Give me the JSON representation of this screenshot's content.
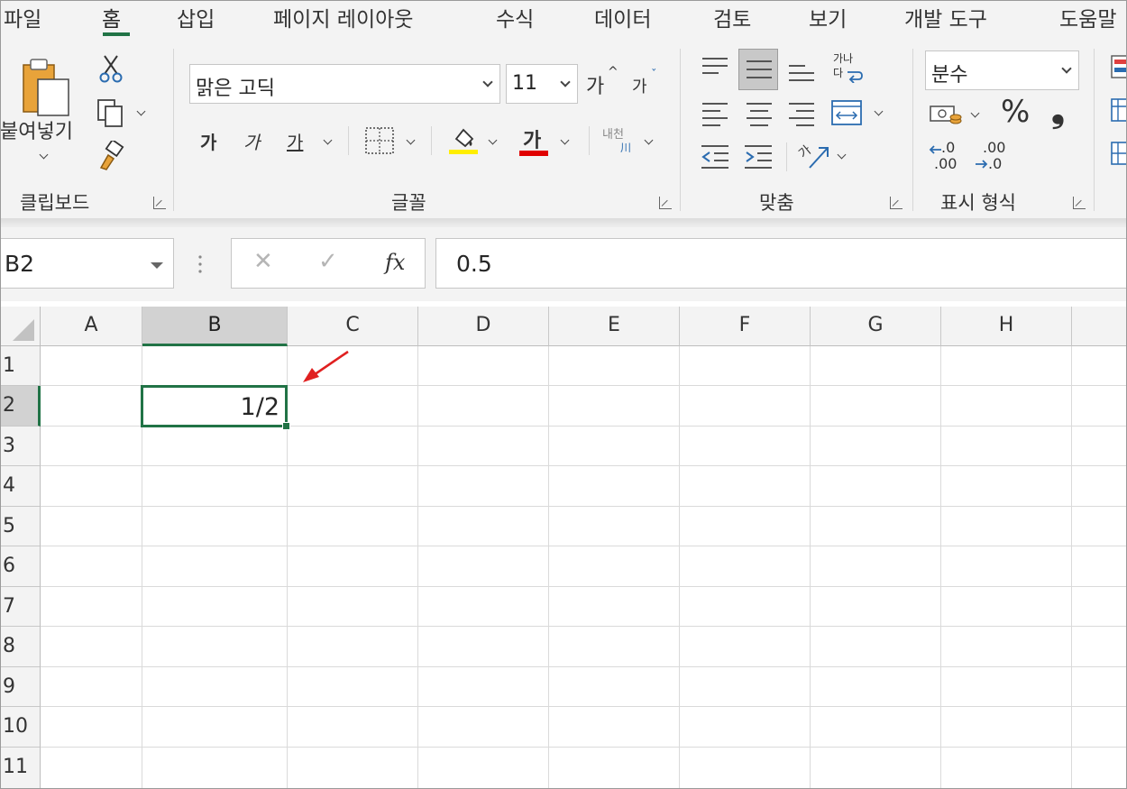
{
  "menu": {
    "tabs": [
      {
        "label": "파일",
        "active": false
      },
      {
        "label": "홈",
        "active": true
      },
      {
        "label": "삽입",
        "active": false
      },
      {
        "label": "페이지 레이아웃",
        "active": false
      },
      {
        "label": "수식",
        "active": false
      },
      {
        "label": "데이터",
        "active": false
      },
      {
        "label": "검토",
        "active": false
      },
      {
        "label": "보기",
        "active": false
      },
      {
        "label": "개발 도구",
        "active": false
      },
      {
        "label": "도움말",
        "active": false
      }
    ]
  },
  "ribbon": {
    "clipboard": {
      "paste_label": "붙여넣기",
      "group_label": "클립보드",
      "icons": [
        "paste-icon",
        "cut-icon",
        "copy-icon",
        "format-painter-icon"
      ]
    },
    "font": {
      "font_name": "맑은 고딕",
      "font_size": "11",
      "grow_label": "가",
      "shrink_label": "가",
      "bold_label": "가",
      "italic_label": "가",
      "underline_label": "가",
      "font_color_label": "가",
      "phonetic_top": "내천",
      "phonetic_bottom": "川",
      "group_label": "글꼴",
      "fill_color": "#ffee00",
      "font_color": "#e00000"
    },
    "alignment": {
      "wrap_top": "가나",
      "wrap_bottom": "다",
      "orientation_label": "가",
      "group_label": "맞춤"
    },
    "number": {
      "format": "분수",
      "percent_label": "%",
      "comma_label": "❟",
      "increase_decimal_top": ".0",
      "increase_decimal_bottom": ".00",
      "decrease_decimal_top": ".00",
      "decrease_decimal_bottom": ".0",
      "group_label": "표시 형식"
    }
  },
  "formula_bar": {
    "name_box": "B2",
    "cancel_label": "✕",
    "enter_label": "✓",
    "fx_label": "fx",
    "value": "0.5"
  },
  "grid": {
    "columns": [
      "A",
      "B",
      "C",
      "D",
      "E",
      "F",
      "G",
      "H"
    ],
    "rows": [
      "1",
      "2",
      "3",
      "4",
      "5",
      "6",
      "7",
      "8",
      "9",
      "10",
      "11"
    ],
    "selected_column": "B",
    "selected_row": "2",
    "cell_b2": "1/2"
  },
  "accent_color": "#217346",
  "annotation_color": "#e02020"
}
